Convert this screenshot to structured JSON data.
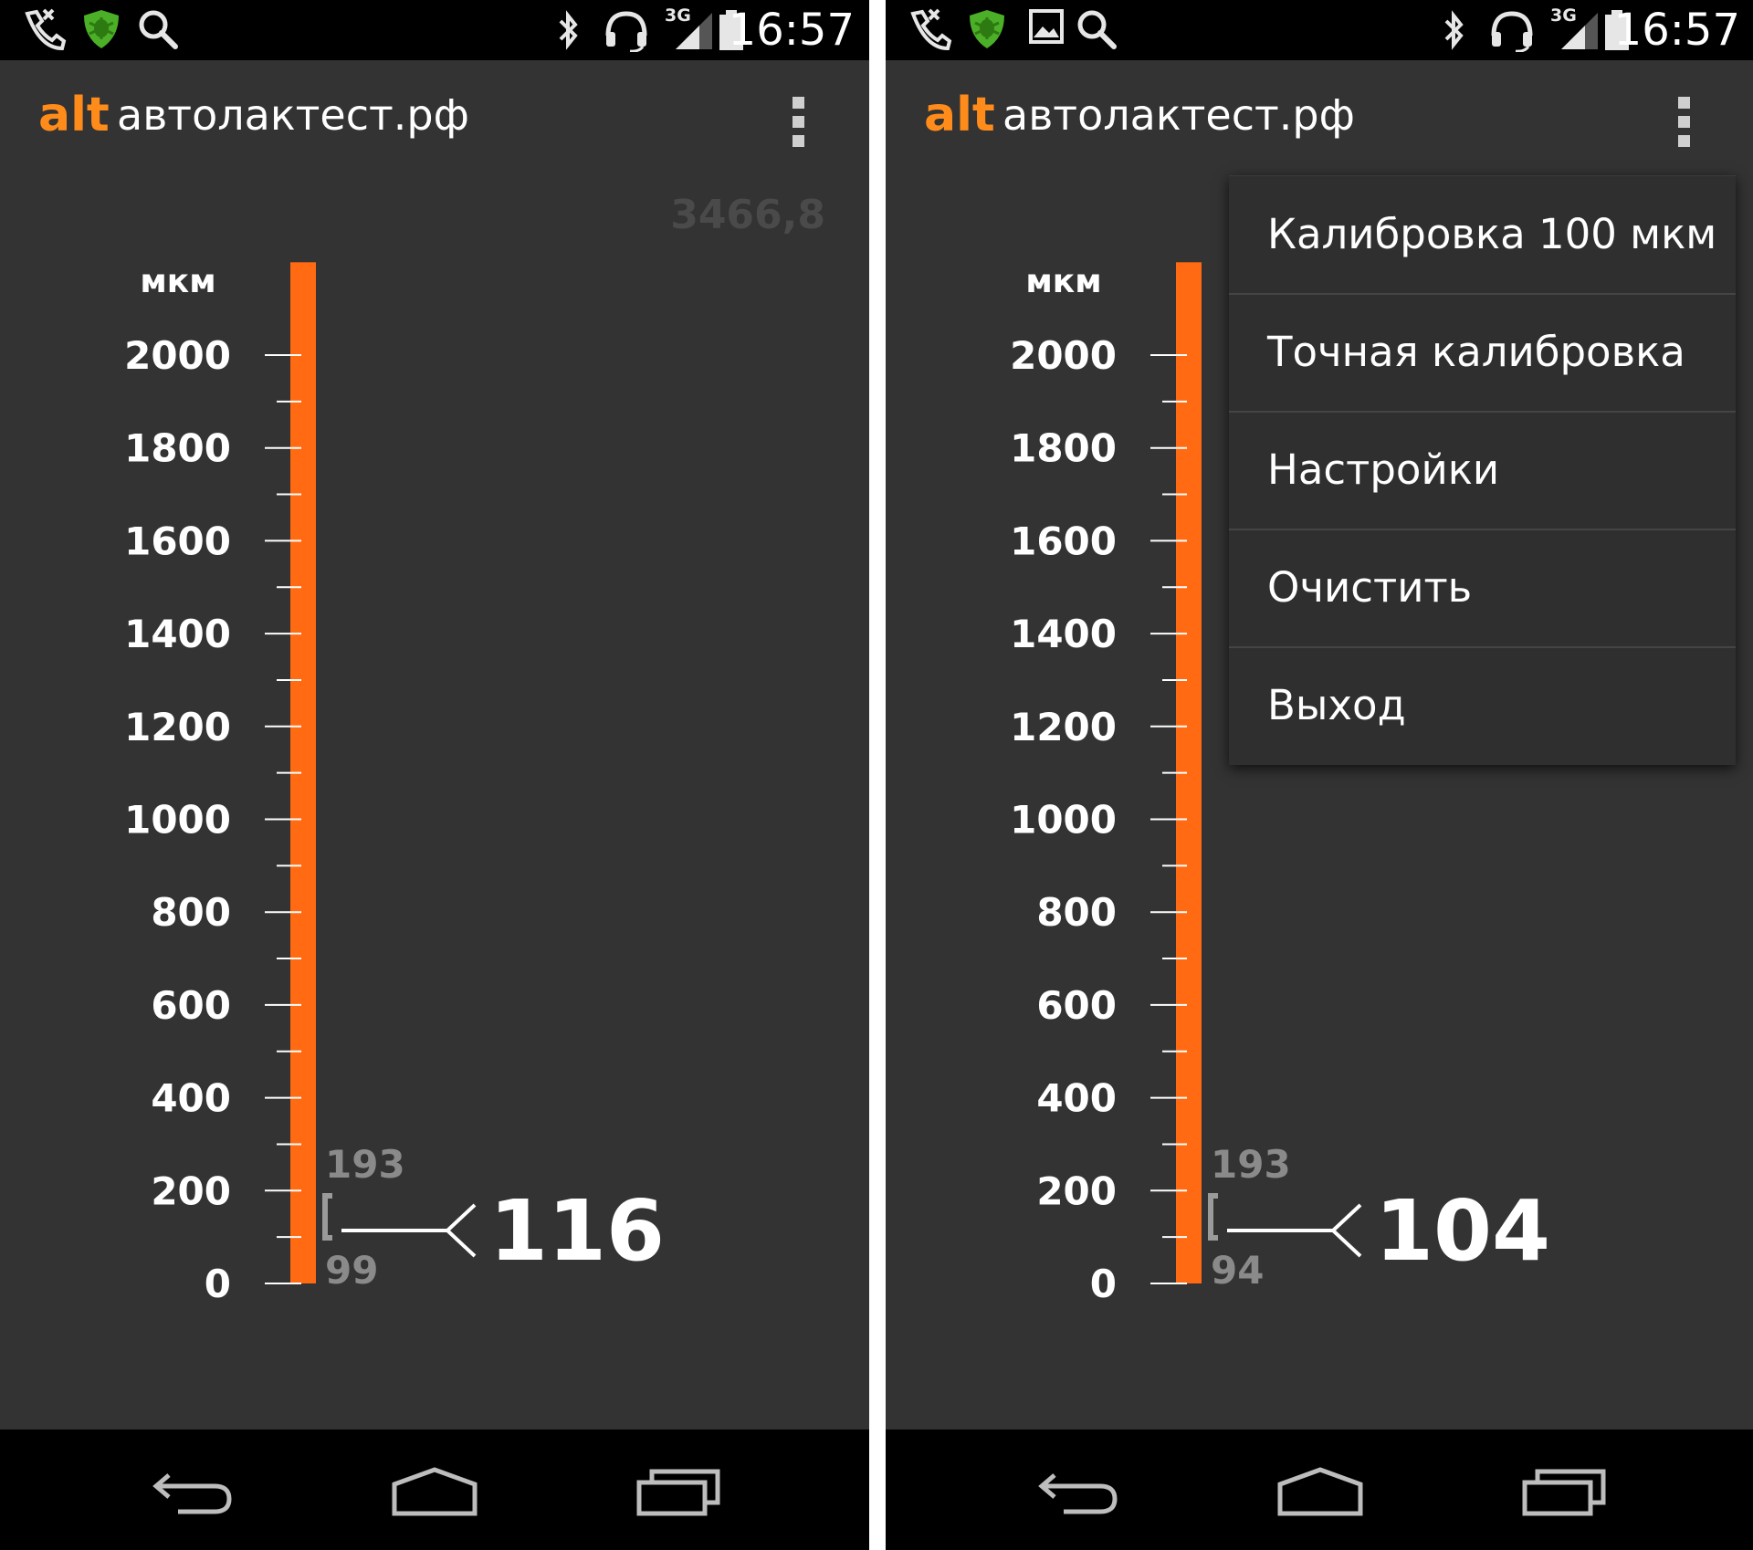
{
  "colors": {
    "accent": "#ff6a13",
    "brand": "#ff8c1a",
    "background": "#333333",
    "bar": "#000000",
    "text": "#ffffff",
    "muted": "#8a8a8a"
  },
  "status_bar": {
    "time": "16:57",
    "network_label": "3G"
  },
  "app_bar": {
    "brand": "alt",
    "title": "автолактест.рф"
  },
  "gauge": {
    "unit": "мкм",
    "scale": {
      "min": 0,
      "max": 2000,
      "major_step": 200,
      "minor_step": 100
    },
    "tick_labels": [
      "2000",
      "1800",
      "1600",
      "1400",
      "1200",
      "1000",
      "800",
      "600",
      "400",
      "200",
      "0"
    ]
  },
  "screens": {
    "left": {
      "faint_value": "3466,8",
      "reading": "116",
      "range_max": "193",
      "range_min": "99",
      "bar_level": 2200
    },
    "right": {
      "reading": "104",
      "range_max": "193",
      "range_min": "94",
      "bar_level": 2200
    }
  },
  "menu": {
    "items": [
      "Калибровка 100 мкм",
      "Точная калибровка",
      "Настройки",
      "Очистить",
      "Выход"
    ]
  },
  "icons": {
    "status_left": [
      "phone-missed-icon",
      "shield-bug-icon",
      "search-icon"
    ],
    "status_right_extra": [
      "image-icon"
    ],
    "status_system": [
      "bluetooth-icon",
      "headset-icon",
      "signal-3g-icon",
      "battery-icon"
    ],
    "nav": [
      "back-icon",
      "home-icon",
      "recents-icon"
    ]
  }
}
